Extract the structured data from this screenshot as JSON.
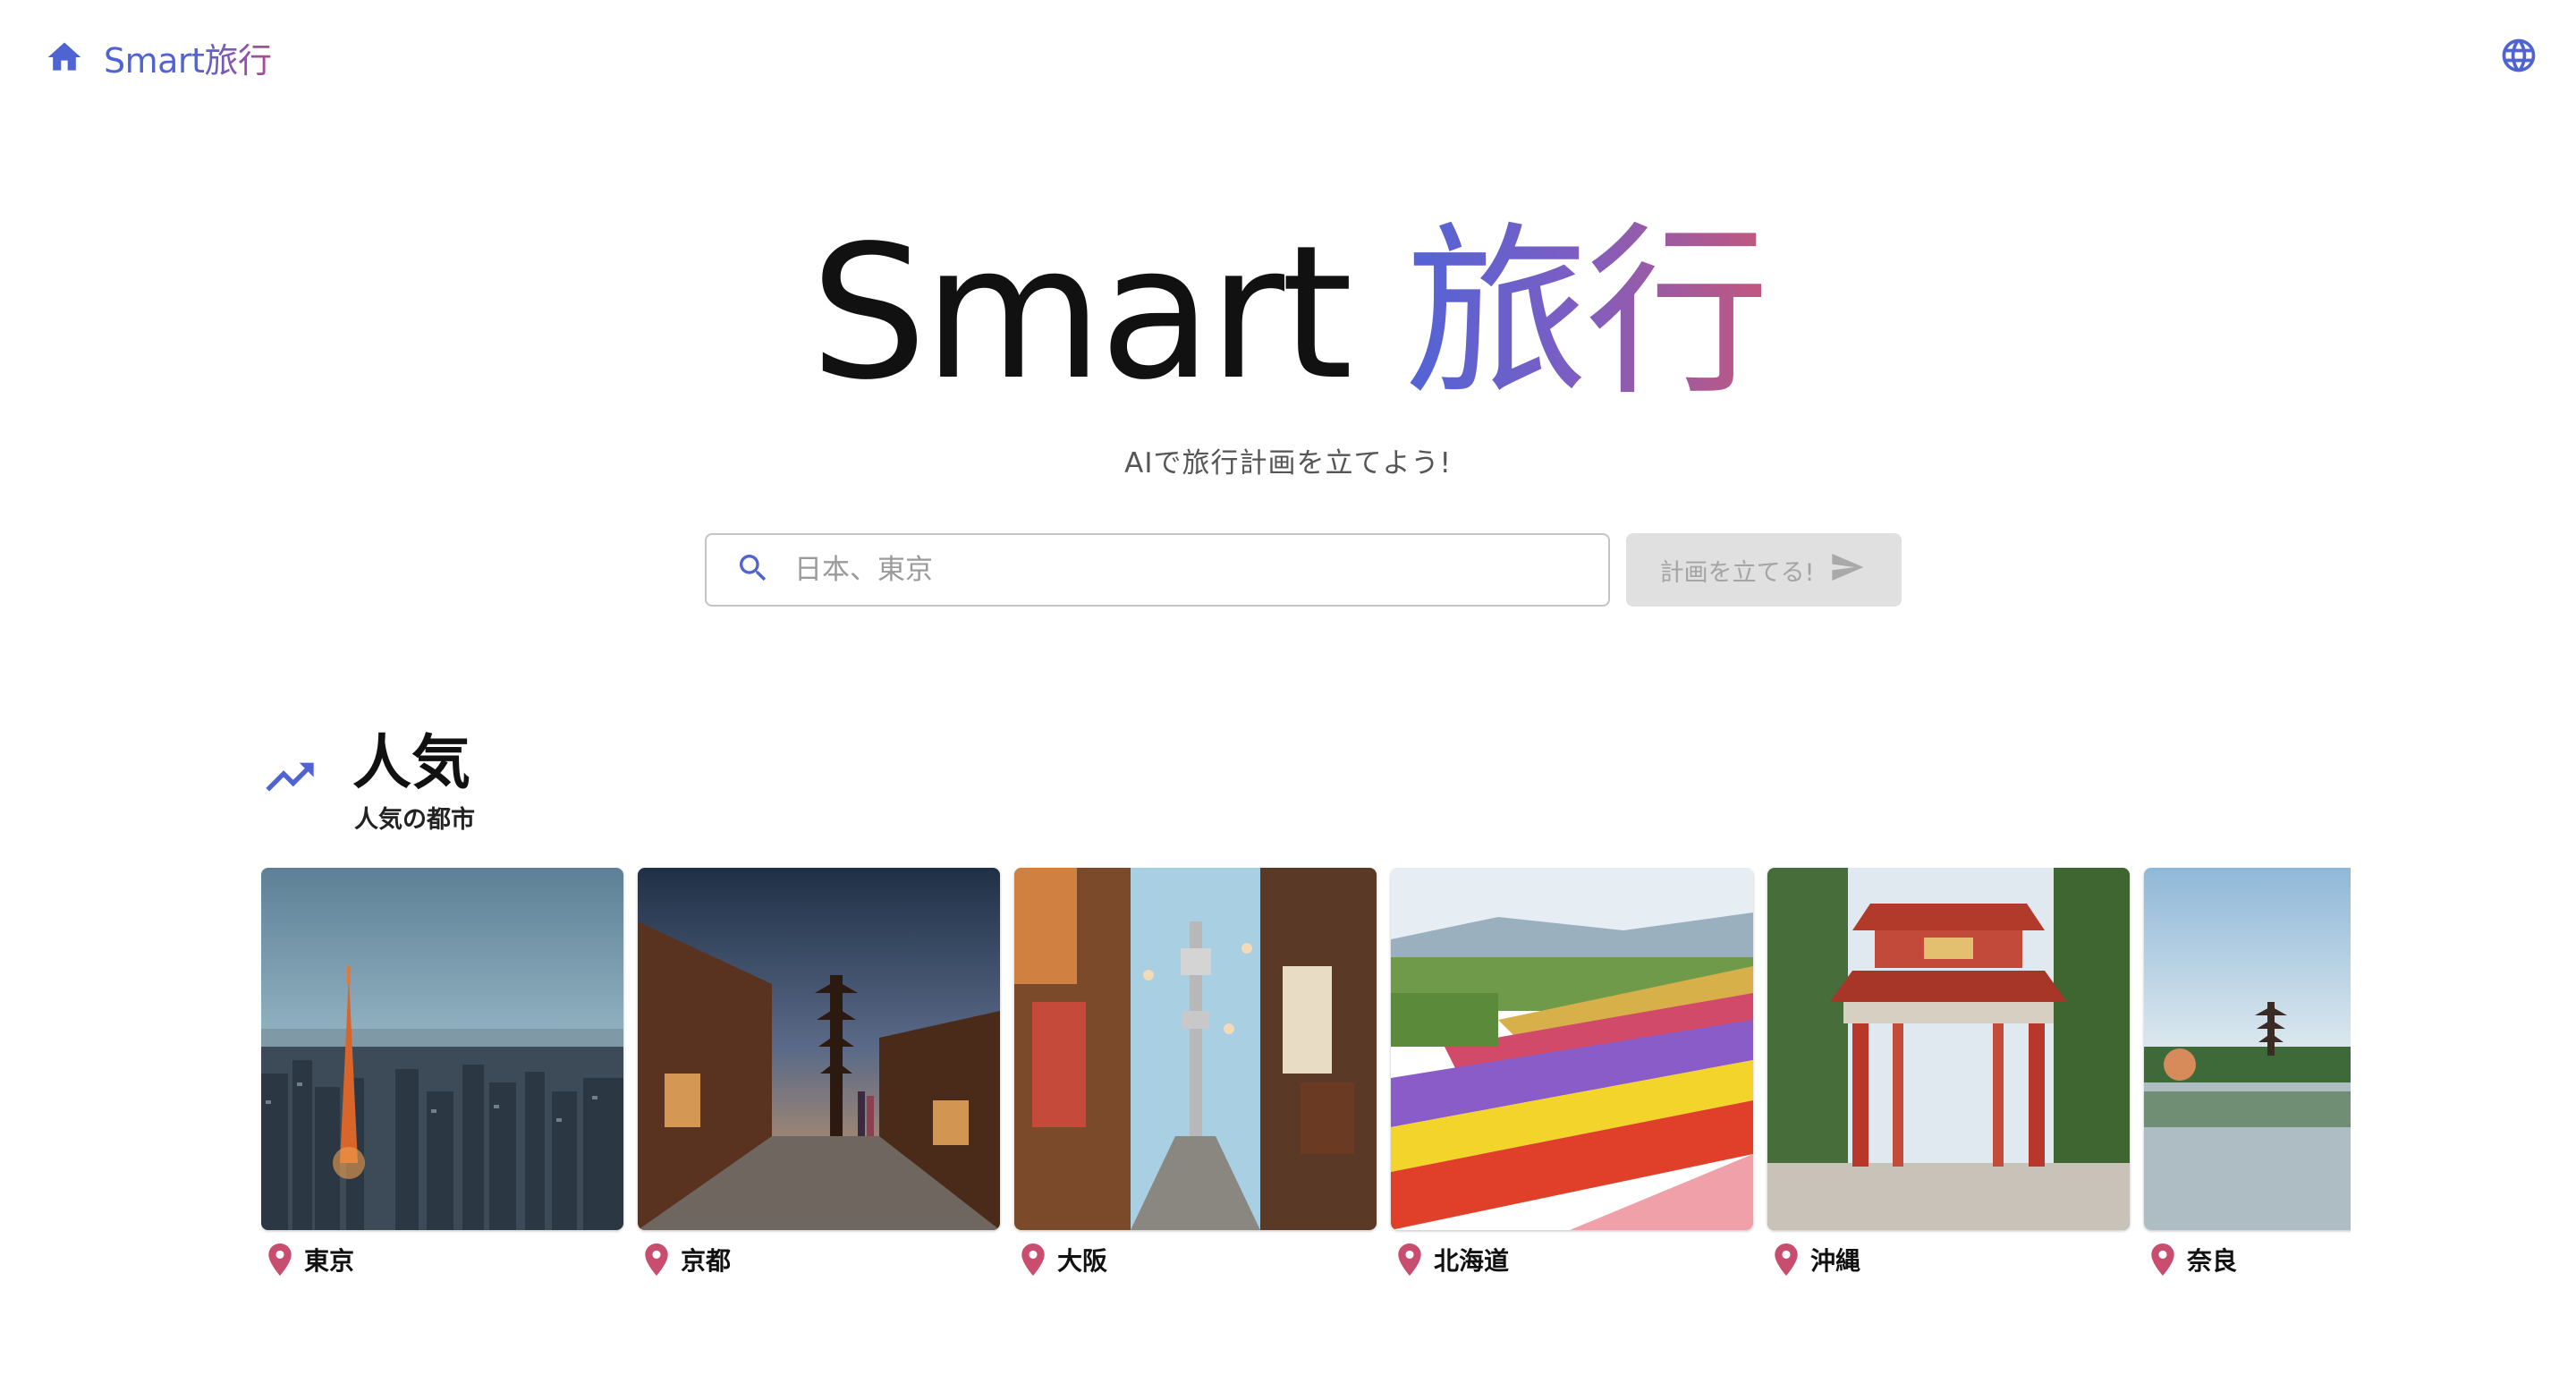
{
  "nav": {
    "home_label": "Smart旅行",
    "home_icon": "home-icon",
    "language_icon": "globe-icon"
  },
  "hero": {
    "title_plain": "Smart ",
    "title_accent": "旅行",
    "subtitle": "AIで旅行計画を立てよう!"
  },
  "search": {
    "placeholder": "日本、東京",
    "value": "",
    "icon": "search-icon",
    "button_label": "計画を立てる!",
    "button_icon": "send-icon"
  },
  "popular": {
    "icon": "trending-up-icon",
    "title": "人気",
    "subtitle": "人気の都市",
    "cities": [
      {
        "name": "東京"
      },
      {
        "name": "京都"
      },
      {
        "name": "大阪"
      },
      {
        "name": "北海道"
      },
      {
        "name": "沖縄"
      },
      {
        "name": "奈良"
      }
    ]
  },
  "colors": {
    "brand_blue": "#4f63d2",
    "brand_pink": "#c2577e",
    "pin": "#c94d6e",
    "button_disabled": "#e0e0e0"
  }
}
